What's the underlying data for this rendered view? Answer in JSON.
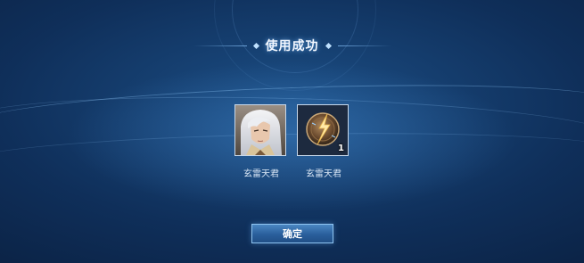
{
  "dialog": {
    "title": "使用成功"
  },
  "rewards": [
    {
      "name": "玄雷天君",
      "icon": "hero-portrait-icon"
    },
    {
      "name": "玄雷天君",
      "icon": "lightning-orb-icon",
      "quantity": "1"
    }
  ],
  "confirm_label": "确定",
  "colors": {
    "background": "#123a6a",
    "button": "#2f68a6",
    "accent": "#8fc4f0"
  }
}
